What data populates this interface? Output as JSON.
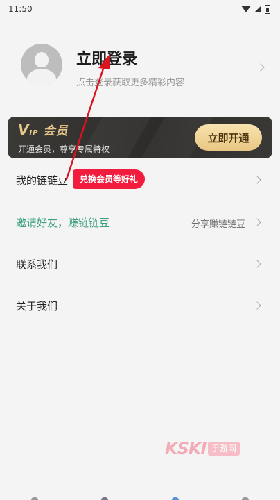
{
  "status_bar": {
    "time": "11:50"
  },
  "profile": {
    "title": "立即登录",
    "subtitle": "点击登录获取更多精彩内容"
  },
  "vip_card": {
    "logo_v": "V",
    "logo_ip": "IP",
    "logo_text": "会员",
    "description": "开通会员，尊享专属特权",
    "button_label": "立即开通"
  },
  "menu": {
    "items": [
      {
        "label": "我的链链豆",
        "badge": "兑换会员等好礼"
      },
      {
        "label": "邀请好友，赚链链豆",
        "right_text": "分享赚链链豆"
      },
      {
        "label": "联系我们"
      },
      {
        "label": "关于我们"
      }
    ]
  },
  "watermark": {
    "logo": "KSKI",
    "tag": "手游网"
  },
  "colors": {
    "accent_red": "#f21d3e",
    "vip_gold": "#e9c98a",
    "invite_green": "#3a9f7c",
    "annotation_arrow": "#d9141f"
  }
}
